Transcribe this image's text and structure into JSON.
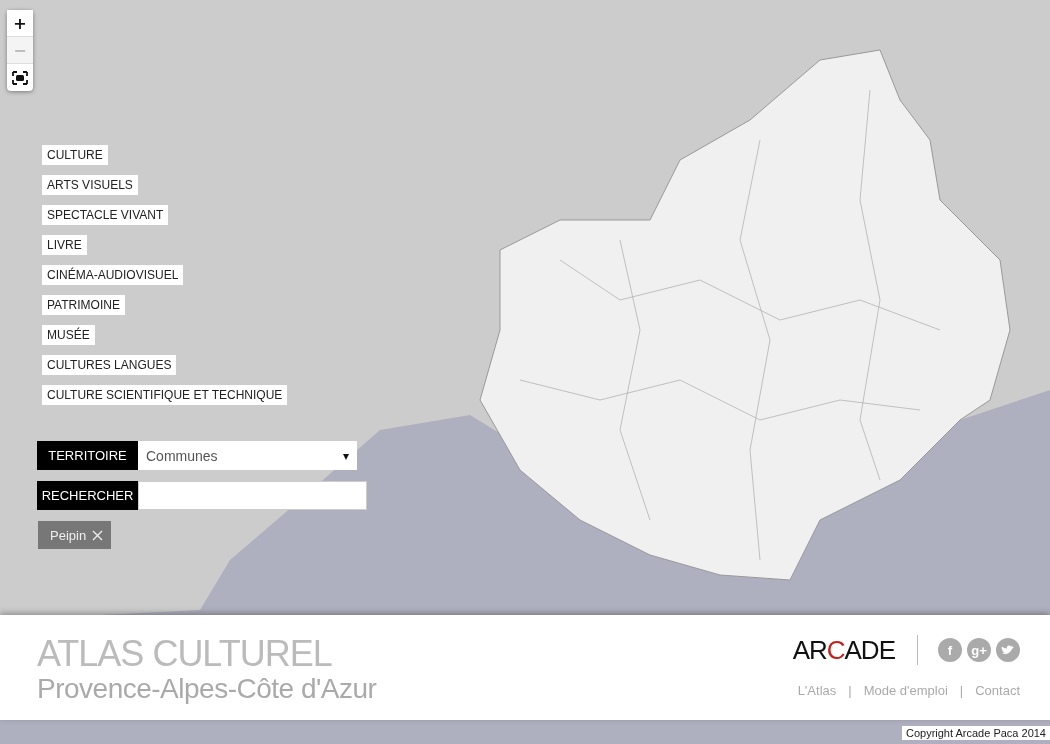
{
  "zoom_controls": [
    {
      "label": "+",
      "disabled": false
    },
    {
      "label": "−",
      "disabled": true
    }
  ],
  "menu": [
    {
      "label": "CULTURE"
    },
    {
      "label": "ARTS VISUELS"
    },
    {
      "label": "SPECTACLE VIVANT"
    },
    {
      "label": "LIVRE"
    },
    {
      "label": "CINÉMA-AUDIOVISUEL"
    },
    {
      "label": "PATRIMOINE"
    },
    {
      "label": "MUSÉE"
    },
    {
      "label": "CULTURES LANGUES"
    },
    {
      "label": "CULTURE SCIENTIFIQUE ET TECHNIQUE"
    }
  ],
  "territoire": {
    "label": "TERRITOIRE",
    "value": "Communes",
    "caret": "▾"
  },
  "search": {
    "label": "RECHERCHER"
  },
  "filters": [
    {
      "label": "Peipin"
    }
  ],
  "footer": {
    "title": "ATLAS CULTUREL",
    "subtitle": "Provence-Alpes-Côte d'Azur",
    "logo": {
      "before": "AR",
      "accent": "C",
      "after": "ADE"
    },
    "social": [
      {
        "kind": "facebook",
        "glyph": "f"
      },
      {
        "kind": "googleplus",
        "glyph": "g+"
      },
      {
        "kind": "twitter"
      }
    ],
    "links": [
      "L'Atlas",
      "Mode d'emploi",
      "Contact"
    ],
    "separator": "|"
  },
  "copyright": "Copyright Arcade Paca 2014"
}
